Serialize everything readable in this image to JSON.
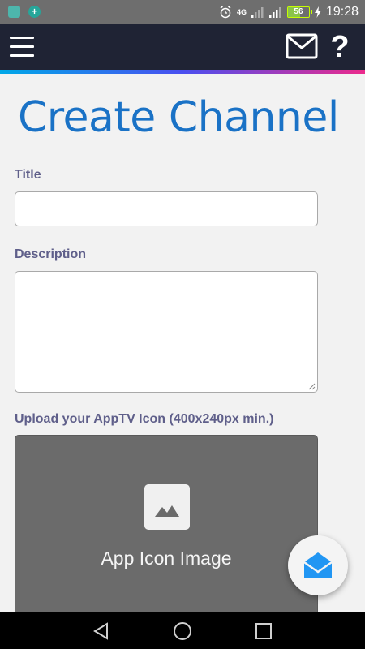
{
  "status_bar": {
    "network": "4G",
    "battery": "56",
    "battery_level": 0.56,
    "time": "19:28"
  },
  "header": {
    "menu_icon": "hamburger-menu-icon",
    "mail_icon": "mail-icon",
    "help_label": "?",
    "strip_colors": [
      "#00a8e8",
      "#4a4ff0",
      "#ec2a8c"
    ]
  },
  "page": {
    "title": "Create Channel"
  },
  "form": {
    "title_label": "Title",
    "title_value": "",
    "description_label": "Description",
    "description_value": "",
    "upload_label": "Upload your AppTV Icon (400x240px min.)",
    "upload_caption": "App Icon Image"
  },
  "colors": {
    "accent": "#1a72c6",
    "label": "#5f5f8a",
    "header_bg": "#1f2334",
    "fab_icon": "#2196f3"
  },
  "nav_bar": {
    "icons": [
      "back-triangle-icon",
      "home-circle-icon",
      "recents-square-icon"
    ]
  }
}
